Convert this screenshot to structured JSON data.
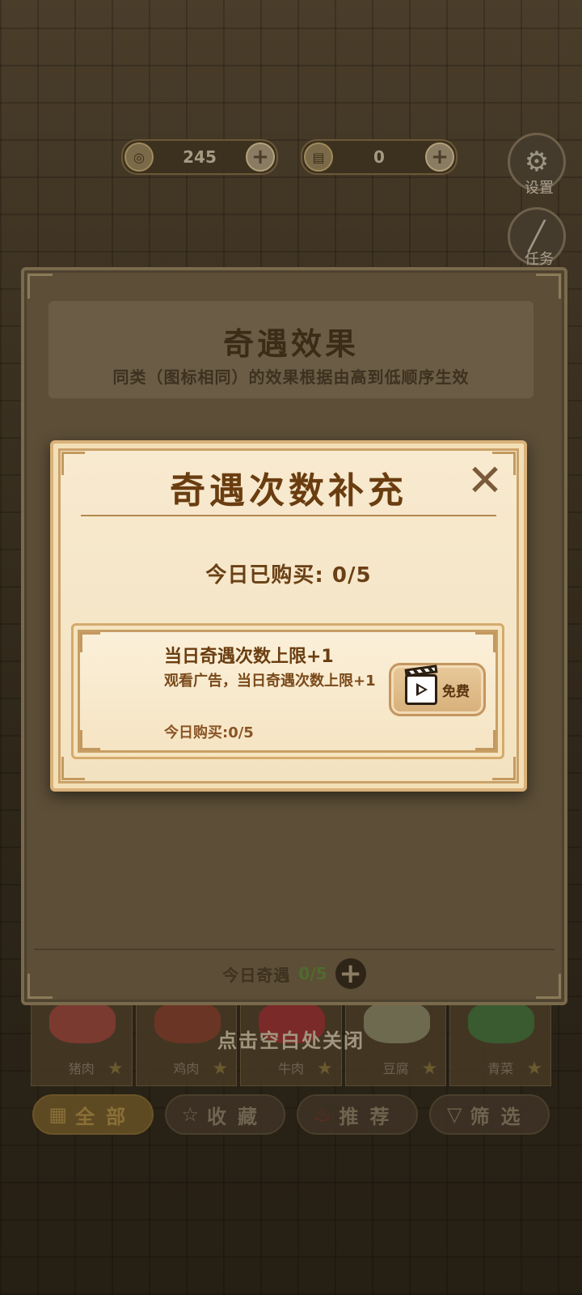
{
  "hud": {
    "coins": "245",
    "scrolls": "0",
    "settings_label": "设置",
    "tasks_label": "任务"
  },
  "effects_panel": {
    "title": "奇遇效果",
    "subtitle": "同类（图标相同）的效果根据由高到低顺序生效",
    "today_label": "今日奇遇",
    "today_count": "0/5"
  },
  "modal": {
    "title": "奇遇次数补充",
    "bought_label": "今日已购买: 0/5",
    "item": {
      "title": "当日奇遇次数上限+1",
      "description": "观看广告，当日奇遇次数上限+1",
      "count": "今日购买:0/5",
      "button_label": "免费"
    }
  },
  "close_hint": "点击空白处关闭",
  "categories": [
    {
      "name": "猪肉",
      "color": "#7a3a30"
    },
    {
      "name": "鸡肉",
      "color": "#6a3524"
    },
    {
      "name": "牛肉",
      "color": "#7a2a28"
    },
    {
      "name": "豆腐",
      "color": "#6e6a50"
    },
    {
      "name": "青菜",
      "color": "#3a5a30"
    }
  ],
  "filters": [
    {
      "label": "全部",
      "icon": "grid-icon"
    },
    {
      "label": "收藏",
      "icon": "star-icon"
    },
    {
      "label": "推荐",
      "icon": "fire-icon"
    },
    {
      "label": "筛选",
      "icon": "filter-icon"
    }
  ],
  "colors": {
    "modal_bg": "#f8ead0",
    "title_brown": "#6a3d10",
    "count_green": "#4f6b2e"
  }
}
